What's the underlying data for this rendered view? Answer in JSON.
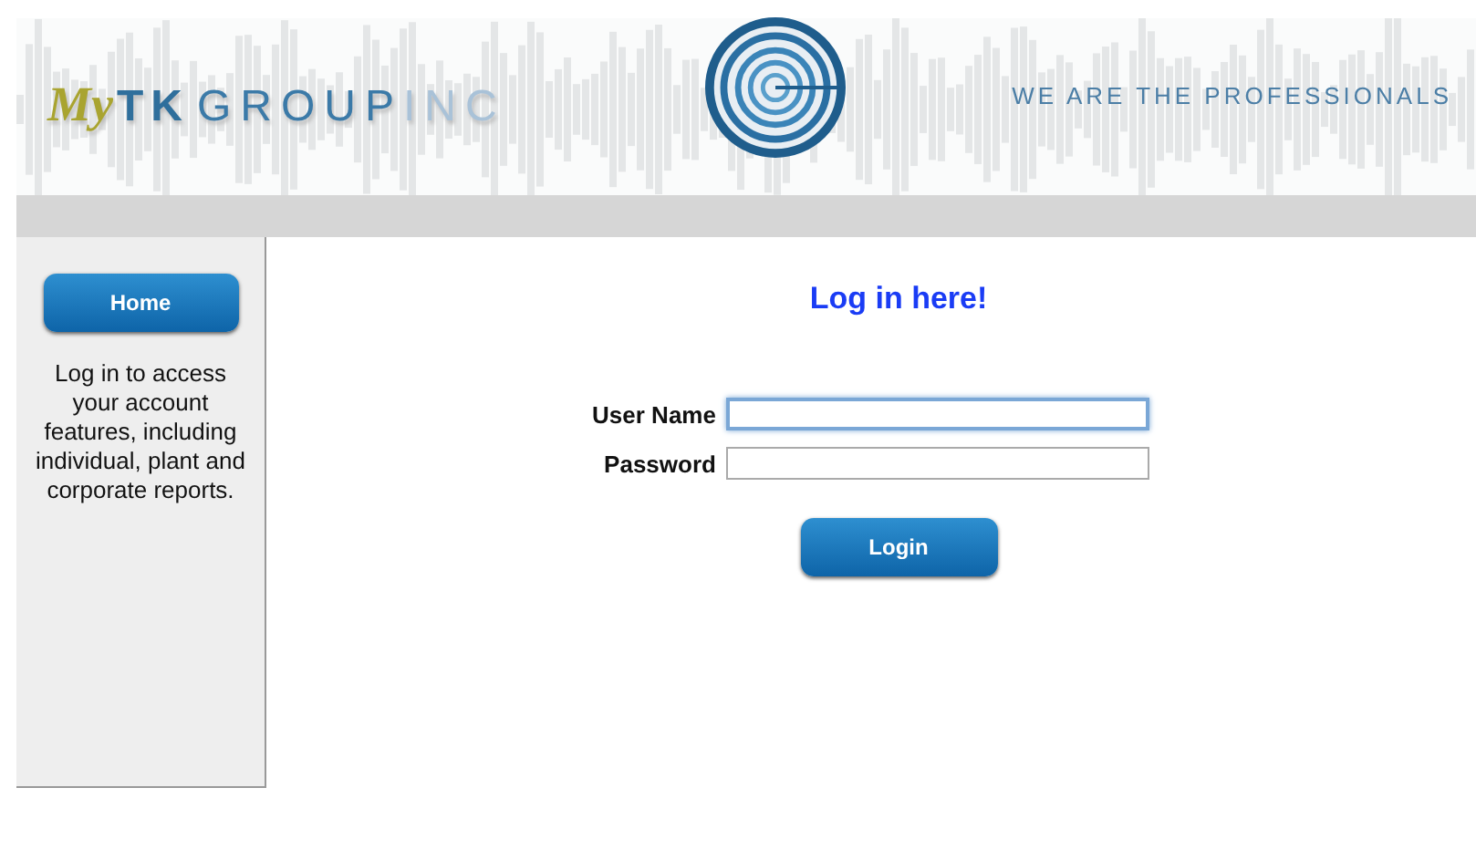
{
  "header": {
    "logo": {
      "prefix": "My",
      "bold": "TK",
      "middle": "GROUP",
      "suffix": "INC"
    },
    "tagline": "WE ARE THE PROFESSIONALS"
  },
  "sidebar": {
    "button": "Home",
    "text": "Log in to access your account features, including individual, plant and corporate reports."
  },
  "login": {
    "title": "Log in here!",
    "fields": [
      {
        "label": "User Name",
        "focused": true
      },
      {
        "label": "Password",
        "focused": false
      }
    ],
    "button": "Login"
  }
}
